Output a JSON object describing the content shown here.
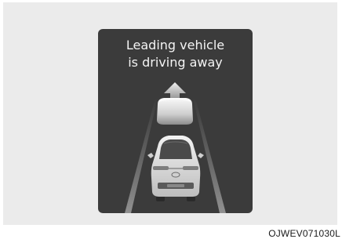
{
  "display": {
    "message_line1": "Leading vehicle",
    "message_line2": "is driving away"
  },
  "figure_code": "OJWEV071030L",
  "colors": {
    "panel_background": "#3b3b3b",
    "page_frame": "#ebebeb",
    "message_text": "#f4f4f4"
  },
  "icons": [
    "leading-vehicle-icon",
    "forward-arrow-icon",
    "own-vehicle-icon",
    "lane-lines"
  ]
}
